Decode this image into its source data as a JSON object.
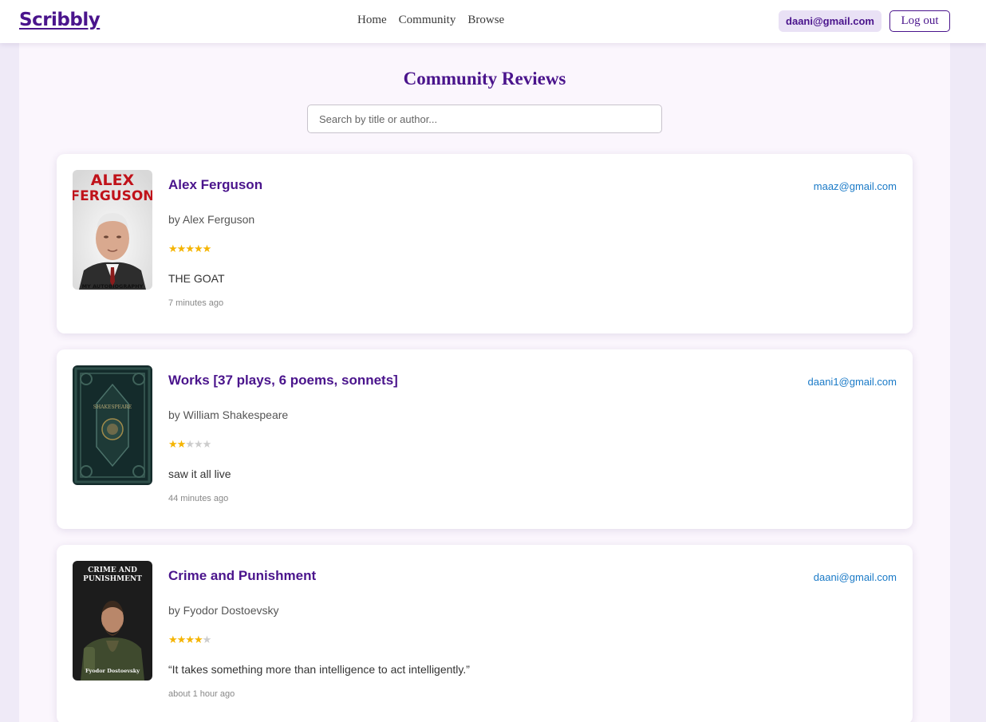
{
  "header": {
    "logo": "Scribbly",
    "nav": [
      "Home",
      "Community",
      "Browse"
    ],
    "user_email": "daani@gmail.com",
    "logout_label": "Log out"
  },
  "page": {
    "title": "Community Reviews",
    "search_placeholder": "Search by title or author..."
  },
  "colors": {
    "brand": "#4a148c",
    "star": "#f5b400",
    "link": "#1a7ac7"
  },
  "reviews": [
    {
      "title": "Alex Ferguson",
      "author": "by Alex Ferguson",
      "reviewer": "maaz@gmail.com",
      "rating": 5,
      "text": "THE GOAT",
      "time": "7 minutes ago",
      "cover": {
        "line1": "ALEX",
        "line2": "FERGUSON",
        "footer": "MY AUTOBIOGRAPHY"
      }
    },
    {
      "title": "Works [37 plays, 6 poems, sonnets]",
      "author": "by William Shakespeare",
      "reviewer": "daani1@gmail.com",
      "rating": 2,
      "text": "saw it all live",
      "time": "44 minutes ago",
      "cover": {
        "line1": "SHAKESPEARE"
      }
    },
    {
      "title": "Crime and Punishment",
      "author": "by Fyodor Dostoevsky",
      "reviewer": "daani@gmail.com",
      "rating": 4,
      "text": "“It takes something more than intelligence to act intelligently.”",
      "time": "about 1 hour ago",
      "cover": {
        "line1": "CRIME AND",
        "line2": "PUNISHMENT",
        "footer": "Fyodor Dostoevsky"
      }
    }
  ]
}
